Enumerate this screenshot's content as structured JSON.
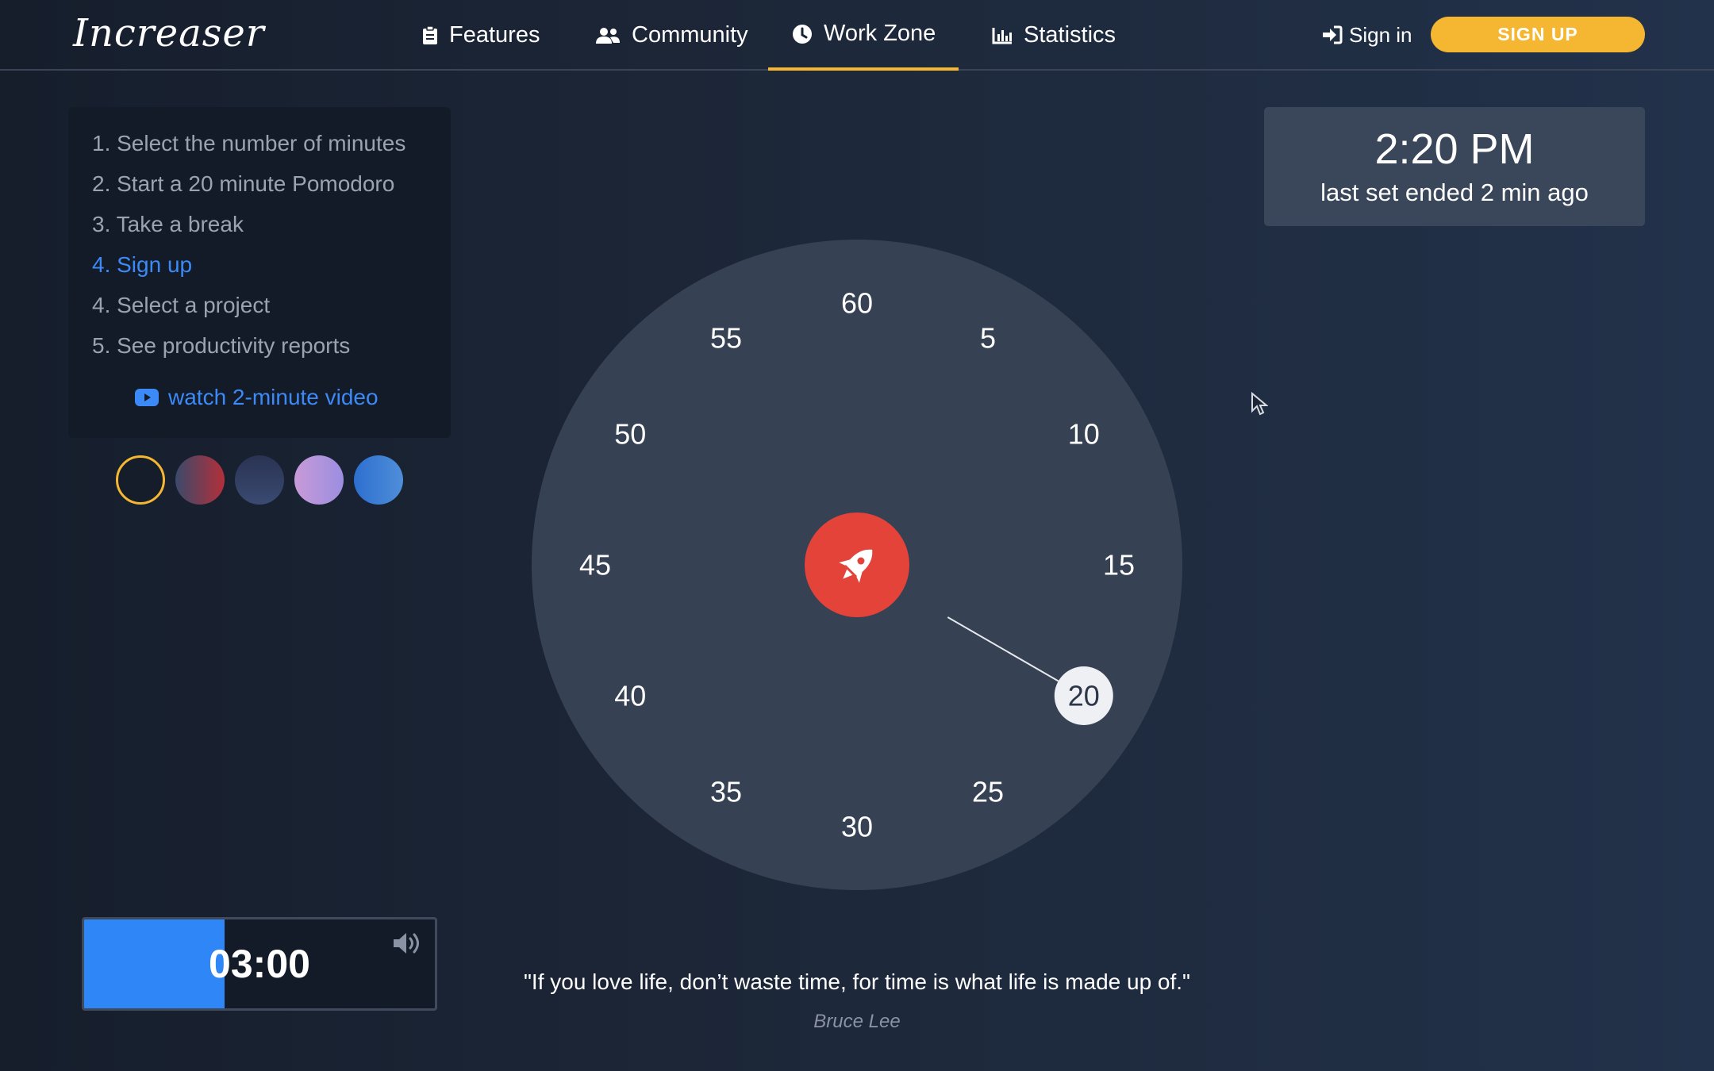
{
  "brand": {
    "logo": "Increaser"
  },
  "nav": {
    "items": [
      {
        "label": "Features",
        "icon": "clipboard-icon"
      },
      {
        "label": "Community",
        "icon": "users-icon"
      },
      {
        "label": "Work Zone",
        "icon": "clock-icon",
        "active": true
      },
      {
        "label": "Statistics",
        "icon": "chart-icon"
      }
    ],
    "signin": "Sign in",
    "signup": "SIGN UP"
  },
  "steps": {
    "items": [
      "1. Select the number of minutes",
      "2. Start a 20 minute Pomodoro",
      "3. Take a break",
      "4. Sign up",
      "4. Select a project",
      "5. See productivity reports"
    ],
    "active_index": 3,
    "video_link": "watch 2-minute video"
  },
  "themes": {
    "selected_index": 0,
    "swatches": [
      "dark-navy",
      "red-gradient",
      "slate-blue",
      "lavender",
      "blue"
    ]
  },
  "clock": {
    "time": "2:20 PM",
    "subtitle": "last set ended 2 min ago"
  },
  "dial": {
    "marks": [
      "60",
      "5",
      "10",
      "15",
      "20",
      "25",
      "30",
      "35",
      "40",
      "45",
      "50",
      "55"
    ],
    "selected_minutes": 20,
    "center_icon": "rocket-icon",
    "colors": {
      "face": "#364254",
      "center": "#e4433a",
      "handle": "#eef0f3"
    }
  },
  "timer": {
    "display": "03:00",
    "progress": 0.4,
    "volume_icon": "volume-icon"
  },
  "quote": {
    "text": "\"If you love life, don’t waste time, for time is what life is made up of.\"",
    "author": "Bruce Lee"
  },
  "colors": {
    "accent": "#f5b731",
    "link": "#3b8af7",
    "timer_fill": "#2f86f6"
  }
}
